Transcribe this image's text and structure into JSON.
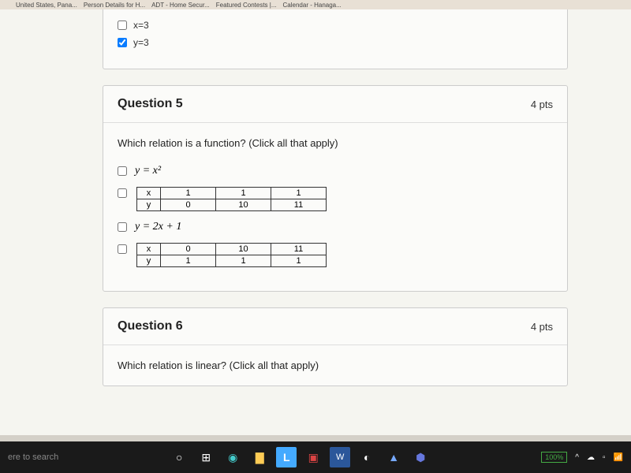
{
  "browser_tabs": [
    "United States, Pana...",
    "Person Details for H...",
    "ADT - Home Secur...",
    "Featured Contests |...",
    "Calendar - Hanaga..."
  ],
  "prev_question": {
    "options": [
      {
        "label": "x=3",
        "checked": false
      },
      {
        "label": "y=3",
        "checked": true
      }
    ]
  },
  "question5": {
    "title": "Question 5",
    "points": "4 pts",
    "prompt": "Which relation is a function? (Click all that apply)",
    "option_a": "y = x²",
    "table_b": {
      "header": "x",
      "row2_label": "y",
      "x_vals": [
        "1",
        "1",
        "1"
      ],
      "y_vals": [
        "0",
        "10",
        "11"
      ]
    },
    "option_c": "y = 2x + 1",
    "table_d": {
      "header": "x",
      "row2_label": "y",
      "x_vals": [
        "0",
        "10",
        "11"
      ],
      "y_vals": [
        "1",
        "1",
        "1"
      ]
    }
  },
  "question6": {
    "title": "Question 6",
    "points": "4 pts",
    "prompt": "Which relation is linear? (Click all that apply)"
  },
  "taskbar": {
    "search_hint": "ere to search",
    "battery": "100%"
  }
}
